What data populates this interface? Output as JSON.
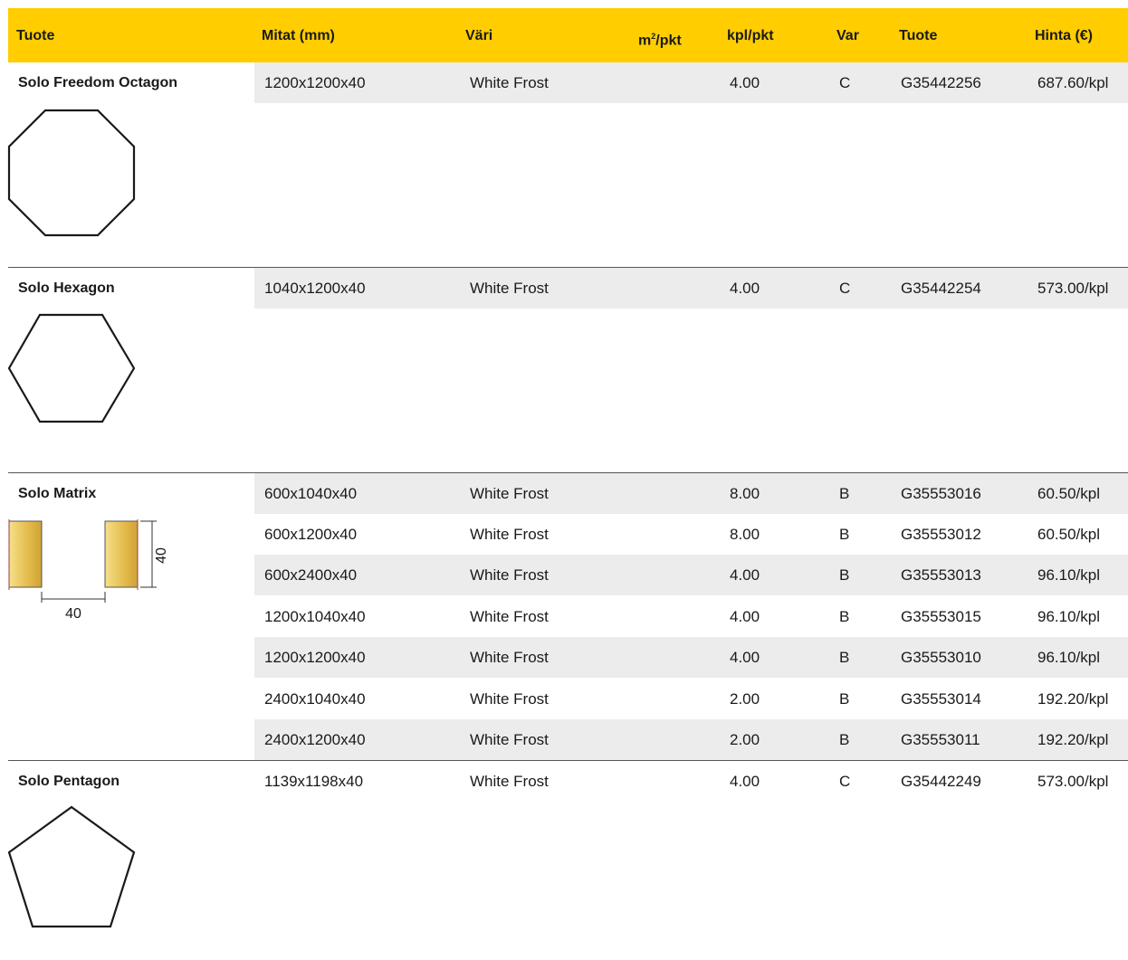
{
  "header": {
    "product": "Tuote",
    "dimensions": "Mitat (mm)",
    "color": "Väri",
    "m2_main": "m",
    "m2_sup": "2",
    "m2_tail": "/pkt",
    "pcs": "kpl/pkt",
    "var": "Var",
    "code": "Tuote",
    "price": "Hinta (€)"
  },
  "products": [
    {
      "name": "Solo Freedom Octagon",
      "icon": "octagon-icon",
      "rows": [
        {
          "dim": "1200x1200x40",
          "color": "White Frost",
          "m2": "",
          "pcs": "4.00",
          "var": "C",
          "code": "G35442256",
          "price": "687.60/kpl"
        }
      ]
    },
    {
      "name": "Solo Hexagon",
      "icon": "hexagon-icon",
      "rows": [
        {
          "dim": "1040x1200x40",
          "color": "White Frost",
          "m2": "",
          "pcs": "4.00",
          "var": "C",
          "code": "G35442254",
          "price": "573.00/kpl"
        }
      ]
    },
    {
      "name": "Solo Matrix",
      "icon": "edge-profile-icon",
      "profile_labels": {
        "height": "40",
        "width": "40"
      },
      "rows": [
        {
          "dim": "600x1040x40",
          "color": "White Frost",
          "m2": "",
          "pcs": "8.00",
          "var": "B",
          "code": "G35553016",
          "price": "60.50/kpl"
        },
        {
          "dim": "600x1200x40",
          "color": "White Frost",
          "m2": "",
          "pcs": "8.00",
          "var": "B",
          "code": "G35553012",
          "price": "60.50/kpl"
        },
        {
          "dim": "600x2400x40",
          "color": "White Frost",
          "m2": "",
          "pcs": "4.00",
          "var": "B",
          "code": "G35553013",
          "price": "96.10/kpl"
        },
        {
          "dim": "1200x1040x40",
          "color": "White Frost",
          "m2": "",
          "pcs": "4.00",
          "var": "B",
          "code": "G35553015",
          "price": "96.10/kpl"
        },
        {
          "dim": "1200x1200x40",
          "color": "White Frost",
          "m2": "",
          "pcs": "4.00",
          "var": "B",
          "code": "G35553010",
          "price": "96.10/kpl"
        },
        {
          "dim": "2400x1040x40",
          "color": "White Frost",
          "m2": "",
          "pcs": "2.00",
          "var": "B",
          "code": "G35553014",
          "price": "192.20/kpl"
        },
        {
          "dim": "2400x1200x40",
          "color": "White Frost",
          "m2": "",
          "pcs": "2.00",
          "var": "B",
          "code": "G35553011",
          "price": "192.20/kpl"
        }
      ]
    },
    {
      "name": "Solo Pentagon",
      "icon": "pentagon-icon",
      "rows": [
        {
          "dim": "1139x1198x40",
          "color": "White Frost",
          "m2": "",
          "pcs": "4.00",
          "var": "C",
          "code": "G35442249",
          "price": "573.00/kpl"
        }
      ]
    }
  ],
  "colors": {
    "header_bg": "#ffcd00",
    "stripe": "#ececec",
    "profile_fill": "#e8c25a"
  }
}
